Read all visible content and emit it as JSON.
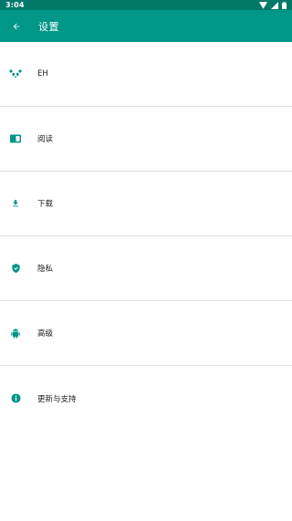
{
  "status_bar": {
    "time": "3:04"
  },
  "toolbar": {
    "title": "设置"
  },
  "settings_items": [
    {
      "label": "EH",
      "icon": "panda-icon"
    },
    {
      "label": "阅读",
      "icon": "book-icon"
    },
    {
      "label": "下载",
      "icon": "download-icon"
    },
    {
      "label": "隐私",
      "icon": "shield-icon"
    },
    {
      "label": "高级",
      "icon": "android-icon"
    },
    {
      "label": "更新与支持",
      "icon": "info-icon"
    }
  ],
  "colors": {
    "status_bar": "#00796b",
    "toolbar": "#009688",
    "accent": "#009688",
    "divider": "#e0e0e0"
  }
}
